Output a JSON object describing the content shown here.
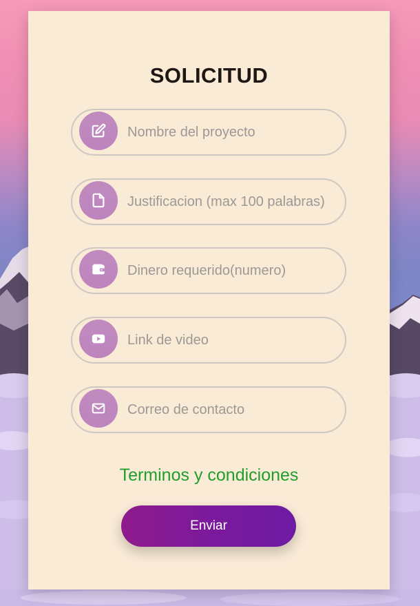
{
  "form": {
    "title": "SOLICITUD",
    "fields": [
      {
        "icon": "edit-icon",
        "placeholder": "Nombre del proyecto",
        "value": ""
      },
      {
        "icon": "file-icon",
        "placeholder": "Justificacion (max 100 palabras)",
        "value": ""
      },
      {
        "icon": "wallet-icon",
        "placeholder": "Dinero requerido(numero)",
        "value": ""
      },
      {
        "icon": "youtube-icon",
        "placeholder": "Link de video",
        "value": ""
      },
      {
        "icon": "envelope-icon",
        "placeholder": "Correo de contacto",
        "value": ""
      }
    ],
    "terms_link": "Terminos y condiciones",
    "submit_label": "Enviar"
  },
  "colors": {
    "card_background": "#faebd7",
    "icon_circle": "#bd84bd",
    "terms_link": "#1f9e2b",
    "button_gradient_start": "#8f1b8c",
    "button_gradient_end": "#6e1ba4"
  }
}
